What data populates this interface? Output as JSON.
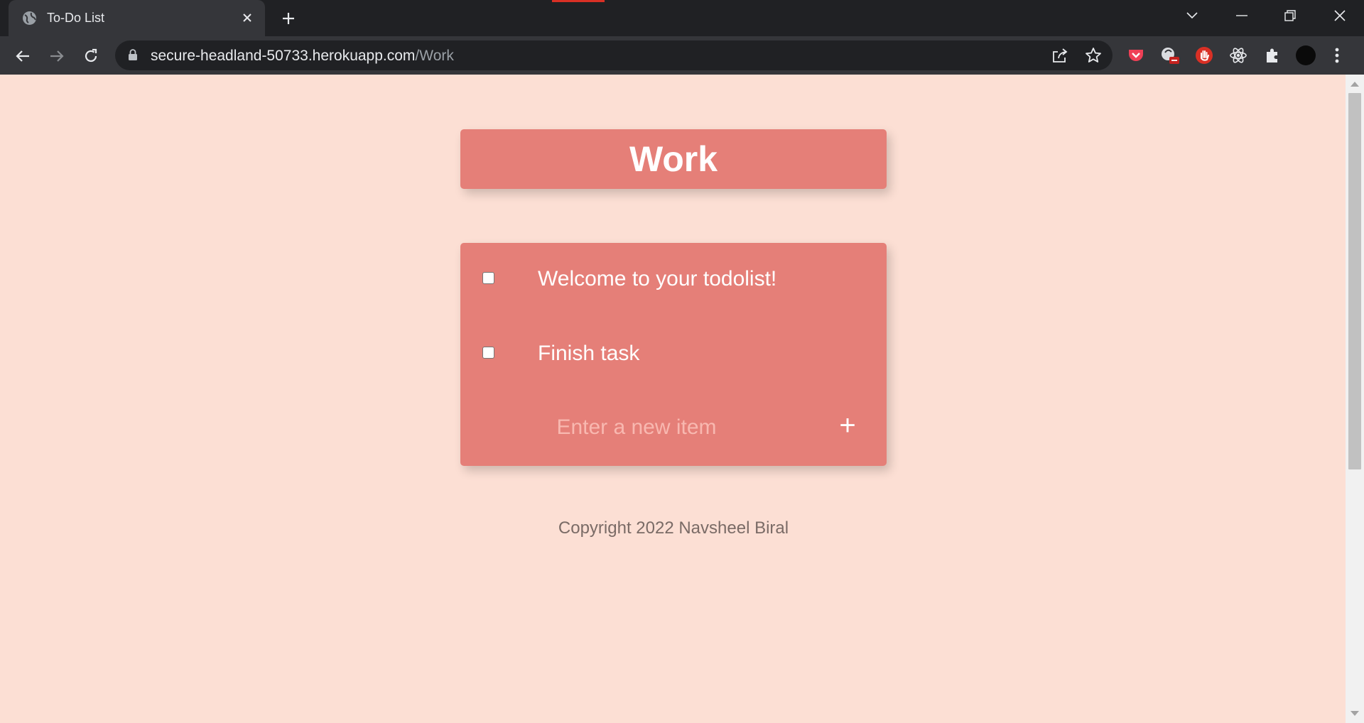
{
  "browser": {
    "tab": {
      "title": "To-Do List",
      "favicon": "globe-icon"
    },
    "url": {
      "host": "secure-headland-50733.herokuapp.com",
      "path": "/Work"
    },
    "colors": {
      "tabbar": "#202124",
      "toolbar": "#35363a",
      "accent_red": "#d93025"
    }
  },
  "page": {
    "title": "Work",
    "items": [
      {
        "text": "Welcome to your todolist!",
        "checked": false
      },
      {
        "text": "Finish task",
        "checked": false
      }
    ],
    "new_item": {
      "placeholder": "Enter a new item",
      "value": ""
    },
    "add_button_label": "+",
    "footer": "Copyright 2022 Navsheel Biral",
    "colors": {
      "background": "#fcdfd4",
      "box": "#e57f78",
      "text": "#ffffff"
    }
  }
}
